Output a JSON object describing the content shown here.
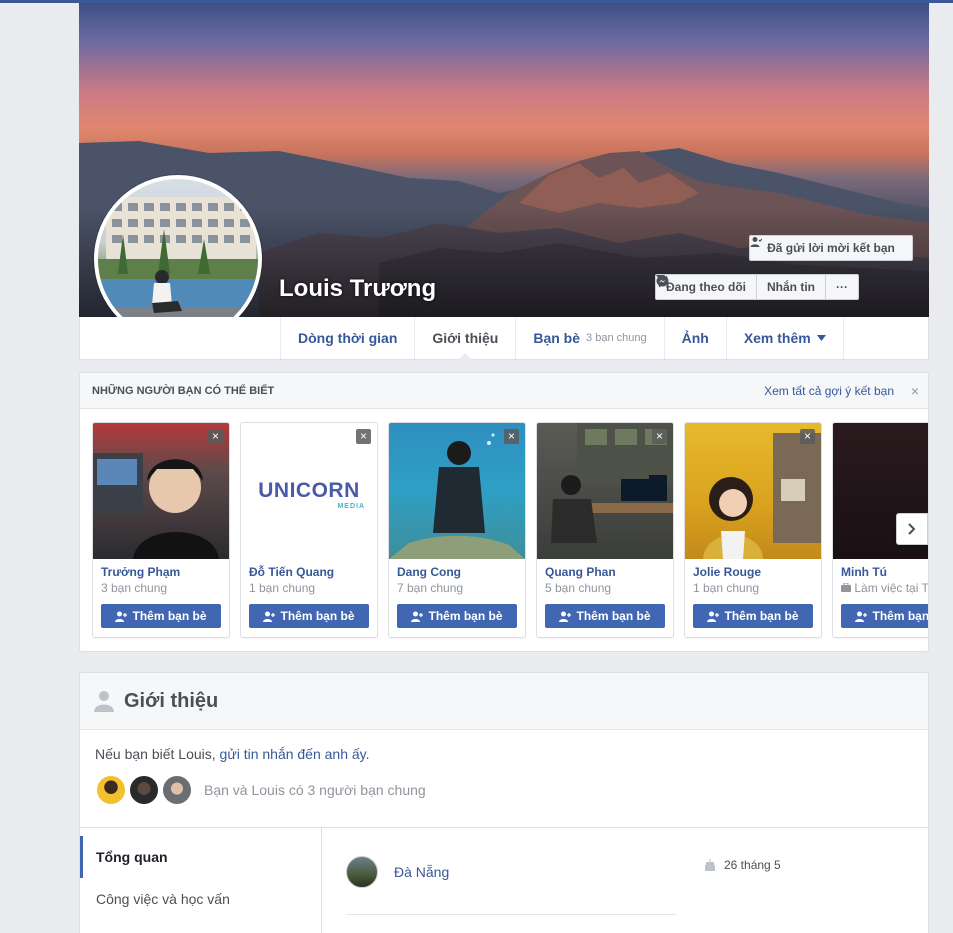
{
  "profile": {
    "name": "Louis Trương"
  },
  "actions": {
    "friend_request_sent": "Đã gửi lời mời kết bạn",
    "following": "Đang theo dõi",
    "message": "Nhắn tin",
    "more": "···"
  },
  "tabs": [
    {
      "label": "Dòng thời gian",
      "sub": ""
    },
    {
      "label": "Giới thiệu",
      "sub": ""
    },
    {
      "label": "Bạn bè",
      "sub": "3 bạn chung"
    },
    {
      "label": "Ảnh",
      "sub": ""
    },
    {
      "label": "Xem thêm",
      "sub": ""
    }
  ],
  "suggestions": {
    "title": "NHỮNG NGƯỜI BẠN CÓ THỂ BIẾT",
    "see_all": "Xem tất cả gợi ý kết bạn",
    "close": "×",
    "add_label": "Thêm bạn bè",
    "unicorn_logo": "UNICORN",
    "unicorn_sub": "MEDIA",
    "people": [
      {
        "name": "Trưởng Phạm",
        "mutual": "3 bạn chung"
      },
      {
        "name": "Đỗ Tiến Quang",
        "mutual": "1 bạn chung"
      },
      {
        "name": "Dang Cong",
        "mutual": "7 bạn chung"
      },
      {
        "name": "Quang Phan",
        "mutual": "5 bạn chung"
      },
      {
        "name": "Jolie Rouge",
        "mutual": "1 bạn chung"
      },
      {
        "name": "Minh Tú",
        "mutual": "Làm việc tại T"
      }
    ]
  },
  "intro": {
    "title": "Giới thiệu",
    "text_prefix": "Nếu bạn biết Louis, ",
    "text_link": "gửi tin nhắn đến anh ấy",
    "text_suffix": ".",
    "mutual_text": "Bạn và Louis có 3 người bạn chung",
    "nav": [
      "Tổng quan",
      "Công việc và học vấn"
    ],
    "city": "Đà Nẵng",
    "birthday": "26 tháng 5"
  },
  "colors": {
    "brand": "#4267b2",
    "link": "#365899",
    "page_bg": "#e9ebee"
  }
}
